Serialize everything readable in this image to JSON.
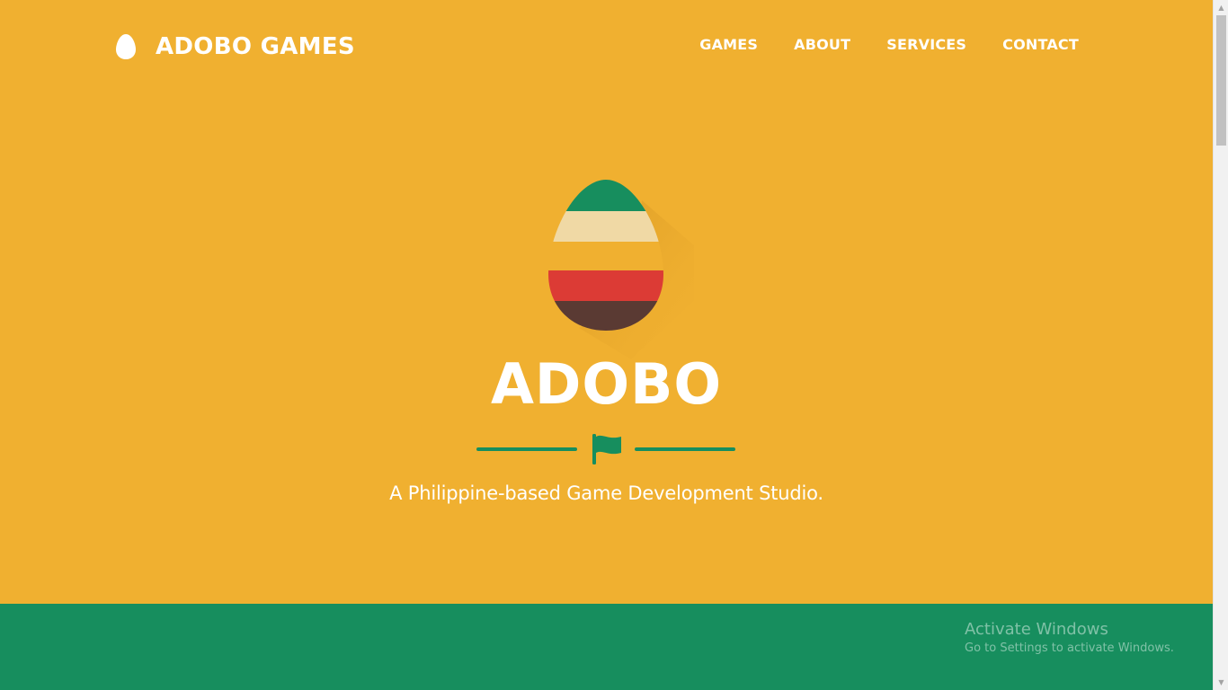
{
  "colors": {
    "hero_bg": "#F0B030",
    "band_bg": "#178E5E",
    "text": "#FFFFFF",
    "egg_green": "#178E5E",
    "egg_cream": "#F0D9A5",
    "egg_yellow": "#F0B030",
    "egg_red": "#DC3B35",
    "egg_brown": "#5A3A33"
  },
  "brand": {
    "name": "ADOBO GAMES",
    "icon": "egg-icon"
  },
  "nav": {
    "items": [
      {
        "label": "GAMES"
      },
      {
        "label": "ABOUT"
      },
      {
        "label": "SERVICES"
      },
      {
        "label": "CONTACT"
      }
    ]
  },
  "hero": {
    "logo_icon": "striped-egg-icon",
    "title": "ADOBO",
    "divider_icon": "flag-icon",
    "tagline": "A Philippine-based Game Development Studio."
  },
  "watermark": {
    "title": "Activate Windows",
    "subtitle": "Go to Settings to activate Windows."
  }
}
